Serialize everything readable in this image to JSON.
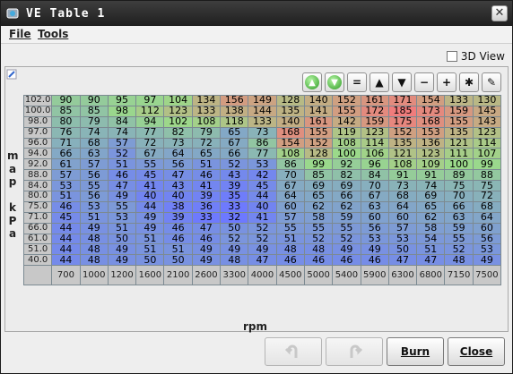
{
  "window": {
    "title": "VE Table 1",
    "close_symbol": "✕"
  },
  "menu": {
    "file": "File",
    "tools": "Tools"
  },
  "view3d_label": "3D View",
  "toolbar": [
    {
      "name": "increment-green-button",
      "symbol": "▲"
    },
    {
      "name": "decrement-green-button",
      "symbol": "▼"
    },
    {
      "name": "set-equal-button",
      "symbol": "="
    },
    {
      "name": "increase-button",
      "symbol": "▲"
    },
    {
      "name": "decrease-button",
      "symbol": "▼"
    },
    {
      "name": "subtract-button",
      "symbol": "−"
    },
    {
      "name": "add-button",
      "symbol": "+"
    },
    {
      "name": "multiply-button",
      "symbol": "✱"
    },
    {
      "name": "interpolate-button",
      "symbol": "✎"
    }
  ],
  "y_axis_label": [
    "m",
    "a",
    "p",
    "",
    "k",
    "P",
    "a"
  ],
  "x_axis_label": "rpm",
  "rows": [
    "102.0",
    "100.0",
    "98.0",
    "97.0",
    "96.0",
    "94.0",
    "92.0",
    "88.0",
    "84.0",
    "80.0",
    "75.0",
    "71.0",
    "66.0",
    "61.0",
    "51.0",
    "40.0"
  ],
  "cols": [
    "700",
    "1000",
    "1200",
    "1600",
    "2100",
    "2600",
    "3300",
    "4000",
    "4500",
    "5000",
    "5400",
    "5900",
    "6300",
    "6800",
    "7150",
    "7500"
  ],
  "values": [
    [
      90,
      90,
      95,
      97,
      104,
      134,
      156,
      149,
      128,
      140,
      152,
      161,
      171,
      154,
      133,
      130
    ],
    [
      85,
      85,
      98,
      112,
      123,
      133,
      138,
      144,
      135,
      141,
      155,
      172,
      185,
      173,
      159,
      145
    ],
    [
      80,
      79,
      84,
      94,
      102,
      108,
      118,
      133,
      140,
      161,
      142,
      159,
      175,
      168,
      155,
      143
    ],
    [
      76,
      74,
      74,
      77,
      82,
      79,
      65,
      73,
      168,
      155,
      119,
      123,
      152,
      153,
      135,
      123
    ],
    [
      71,
      68,
      57,
      72,
      73,
      72,
      67,
      86,
      154,
      152,
      108,
      114,
      135,
      136,
      121,
      114
    ],
    [
      66,
      63,
      52,
      67,
      64,
      65,
      66,
      77,
      108,
      128,
      100,
      106,
      121,
      123,
      111,
      107
    ],
    [
      61,
      57,
      51,
      55,
      56,
      51,
      52,
      53,
      86,
      99,
      92,
      96,
      108,
      109,
      100,
      99
    ],
    [
      57,
      56,
      46,
      45,
      47,
      46,
      43,
      42,
      70,
      85,
      82,
      84,
      91,
      91,
      89,
      88
    ],
    [
      53,
      55,
      47,
      41,
      43,
      41,
      39,
      45,
      67,
      69,
      69,
      70,
      73,
      74,
      75,
      75
    ],
    [
      51,
      56,
      49,
      40,
      40,
      39,
      35,
      44,
      64,
      65,
      66,
      67,
      68,
      69,
      70,
      72
    ],
    [
      46,
      53,
      55,
      44,
      38,
      36,
      33,
      40,
      60,
      62,
      62,
      63,
      64,
      65,
      66,
      68
    ],
    [
      45,
      51,
      53,
      49,
      39,
      33,
      32,
      41,
      57,
      58,
      59,
      60,
      60,
      62,
      63,
      64
    ],
    [
      44,
      49,
      51,
      49,
      46,
      47,
      50,
      52,
      55,
      55,
      55,
      56,
      57,
      58,
      59,
      60
    ],
    [
      44,
      48,
      50,
      51,
      46,
      46,
      52,
      52,
      51,
      52,
      52,
      53,
      53,
      54,
      55,
      56
    ],
    [
      44,
      48,
      49,
      51,
      51,
      49,
      49,
      49,
      48,
      48,
      49,
      49,
      50,
      51,
      52,
      53
    ],
    [
      44,
      48,
      49,
      50,
      50,
      49,
      48,
      47,
      46,
      46,
      46,
      46,
      47,
      47,
      48,
      49
    ]
  ],
  "buttons": {
    "undo": "",
    "redo": "",
    "burn": "Burn",
    "close": "Close"
  },
  "colors": {
    "low": "#6d79ff",
    "mid": "#9bd98a",
    "high": "#f07c7c"
  }
}
